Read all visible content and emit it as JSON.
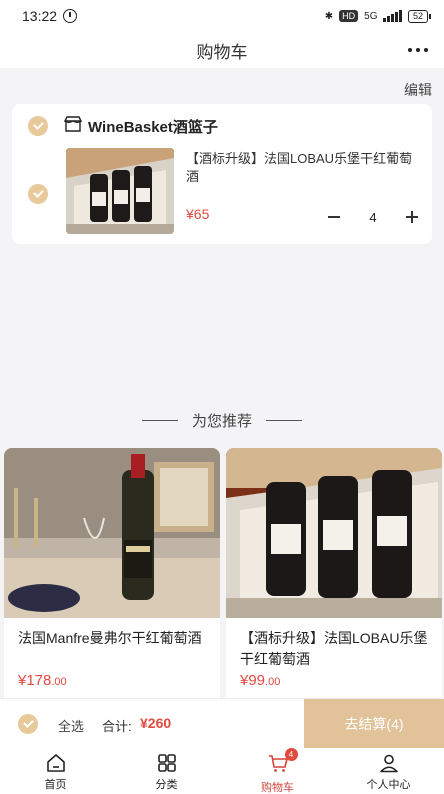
{
  "status_bar": {
    "time": "13:22",
    "network": "5G",
    "hd": "HD",
    "battery": "52"
  },
  "header": {
    "title": "购物车"
  },
  "actions": {
    "edit": "编辑"
  },
  "cart": {
    "store_name": "WineBasket酒篮子",
    "item": {
      "title": "【酒标升级】法国LOBAU乐堡干红葡萄酒",
      "price": "¥65",
      "quantity": "4"
    }
  },
  "recommend": {
    "heading": "为您推荐",
    "products": [
      {
        "name": "法国Manfre曼弗尔干红葡萄酒",
        "price": "¥178",
        "cents": ".00"
      },
      {
        "name": "【酒标升级】法国LOBAU乐堡干红葡萄酒",
        "price": "¥99",
        "cents": ".00"
      }
    ]
  },
  "checkout": {
    "select_all": "全选",
    "total_label": "合计:",
    "total_value": "¥260",
    "button_label": "去结算(4)"
  },
  "tabs": [
    {
      "label": "首页",
      "icon": "home-icon"
    },
    {
      "label": "分类",
      "icon": "grid-icon"
    },
    {
      "label": "购物车",
      "icon": "cart-icon",
      "badge": "4",
      "active": true
    },
    {
      "label": "个人中心",
      "icon": "person-icon"
    }
  ],
  "colors": {
    "accent": "#e2c299",
    "price": "#e14a3f",
    "active_tab": "#d2443a"
  }
}
